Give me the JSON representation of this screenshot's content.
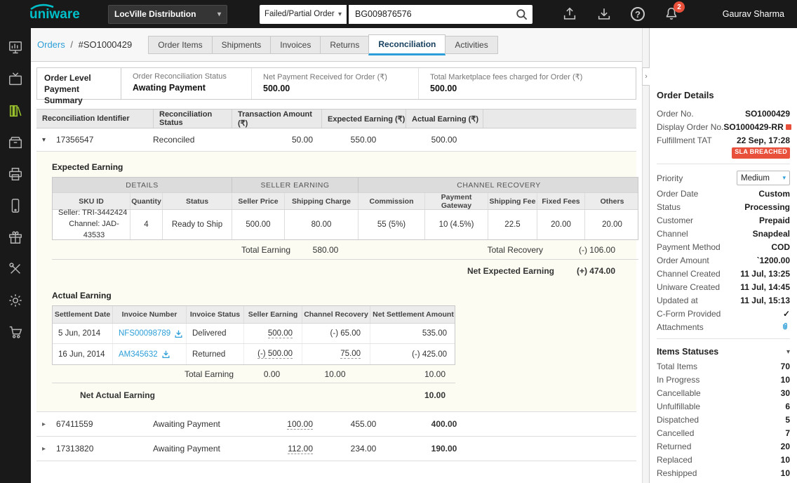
{
  "colors": {
    "accent_blue": "#2d9fd8",
    "brand_teal": "#00bfc9",
    "alert_red": "#e8503b",
    "active_green": "#9dc62d"
  },
  "icons": {
    "caret_down": "▾",
    "triangle_down": "▾",
    "triangle_right": "▸",
    "chevron_right": "›",
    "check": "✓",
    "question": "?"
  },
  "topbar": {
    "logo": "uniware",
    "facility": {
      "label": "LocVille Distribution"
    },
    "search": {
      "type_label": "Failed/Partial Order",
      "value": "BG009876576"
    },
    "notifications": {
      "count": "2"
    },
    "user": {
      "name": "Gaurav Sharma"
    }
  },
  "breadcrumb": {
    "section": "Orders",
    "separator": "/",
    "current": "#SO1000429"
  },
  "tabs": [
    {
      "label": "Order Items"
    },
    {
      "label": "Shipments"
    },
    {
      "label": "Invoices"
    },
    {
      "label": "Returns"
    },
    {
      "label": "Reconciliation"
    },
    {
      "label": "Activities"
    }
  ],
  "payment_summary": {
    "title_line1": "Order Level",
    "title_line2": "Payment Summary",
    "status_label": "Order Reconciliation Status",
    "status_value": "Awating Payment",
    "net_payment_label": "Net Payment Received for Order (₹)",
    "net_payment_value": "500.00",
    "marketplace_fees_label": "Total Marketplace fees charged for Order (₹)",
    "marketplace_fees_value": "500.00"
  },
  "recon_table": {
    "headers": [
      "Reconciliation Identifier",
      "Reconciliation Status",
      "Transaction Amount (₹)",
      "Expected Earning (₹)",
      "Actual Earning (₹)"
    ],
    "rows": [
      {
        "id": "17356547",
        "status": "Reconciled",
        "transaction": "50.00",
        "expected": "550.00",
        "actual": "500.00"
      },
      {
        "id": "67411559",
        "status": "Awaiting Payment",
        "transaction": "100.00",
        "expected": "455.00",
        "actual": "400.00"
      },
      {
        "id": "17313820",
        "status": "Awaiting Payment",
        "transaction": "112.00",
        "expected": "234.00",
        "actual": "190.00"
      }
    ]
  },
  "expected_earning": {
    "title": "Expected Earning",
    "groups": [
      "DETAILS",
      "SELLER EARNING",
      "CHANNEL RECOVERY"
    ],
    "columns": [
      "SKU ID",
      "Quantity",
      "Status",
      "Seller Price",
      "Shipping Charge",
      "Commission",
      "Payment Gateway",
      "Shipping Fee",
      "Fixed Fees",
      "Others"
    ],
    "row": {
      "seller_sku": "Seller: TRI-3442424",
      "channel_sku": "Channel: JAD-43533",
      "quantity": "4",
      "status": "Ready to Ship",
      "seller_price": "500.00",
      "shipping_charge": "80.00",
      "commission": "55 (5%)",
      "payment_gateway": "10 (4.5%)",
      "shipping_fee": "22.5",
      "fixed_fees": "20.00",
      "others": "20.00"
    },
    "total_earning_label": "Total Earning",
    "total_earning_value": "580.00",
    "total_recovery_label": "Total Recovery",
    "total_recovery_value": "(-) 106.00",
    "net_label": "Net Expected Earning",
    "net_value": "(+) 474.00"
  },
  "actual_earning": {
    "title": "Actual Earning",
    "columns": [
      "Settlement Date",
      "Invoice Number",
      "Invoice Status",
      "Seller Earning",
      "Channel Recovery",
      "Net Settlement Amount"
    ],
    "rows": [
      {
        "date": "5 Jun, 2014",
        "invoice": "NFS00098789",
        "status": "Delivered",
        "seller_earning": "500.00",
        "channel_recovery": "(-) 65.00",
        "net": "535.00"
      },
      {
        "date": "16 Jun, 2014",
        "invoice": "AM345632",
        "status": "Returned",
        "seller_earning": "(-) 500.00",
        "channel_recovery": "75.00",
        "net": "(-) 425.00"
      }
    ],
    "total_label": "Total Earning",
    "total_seller_earning": "0.00",
    "total_channel_recovery": "10.00",
    "total_net": "10.00",
    "net_label": "Net Actual Earning",
    "net_value": "10.00"
  },
  "order_details": {
    "title": "Order Details",
    "order_no_label": "Order No.",
    "order_no": "SO1000429",
    "display_order_no_label": "Display Order No.",
    "display_order_no": "SO1000429-RR",
    "fulfillment_tat_label": "Fulfillment TAT",
    "fulfillment_tat": "22 Sep, 17:28",
    "sla_badge": "SLA BREACHED",
    "priority_label": "Priority",
    "priority_value": "Medium",
    "rows": [
      {
        "label": "Order Date",
        "value": "Custom"
      },
      {
        "label": "Status",
        "value": "Processing"
      },
      {
        "label": "Customer",
        "value": "Prepaid"
      },
      {
        "label": "Channel",
        "value": "Snapdeal"
      },
      {
        "label": "Payment Method",
        "value": "COD"
      },
      {
        "label": "Order Amount",
        "value": "`1200.00"
      },
      {
        "label": "Channel Created",
        "value": "11 Jul, 13:25"
      },
      {
        "label": "Uniware Created",
        "value": "11 Jul, 14:45"
      },
      {
        "label": "Updated at",
        "value": "11 Jul, 15:13"
      }
    ],
    "cform_label": "C-Form Provided",
    "attachments_label": "Attachments"
  },
  "items_statuses": {
    "title": "Items Statuses",
    "rows": [
      {
        "label": "Total Items",
        "value": "70"
      },
      {
        "label": "In Progress",
        "value": "10"
      },
      {
        "label": "Cancellable",
        "value": "30"
      },
      {
        "label": "Unfulfillable",
        "value": "6"
      },
      {
        "label": "Dispatched",
        "value": "5"
      },
      {
        "label": "Cancelled",
        "value": "7"
      },
      {
        "label": "Returned",
        "value": "20"
      },
      {
        "label": "Replaced",
        "value": "10"
      },
      {
        "label": "Reshipped",
        "value": "10"
      }
    ]
  }
}
